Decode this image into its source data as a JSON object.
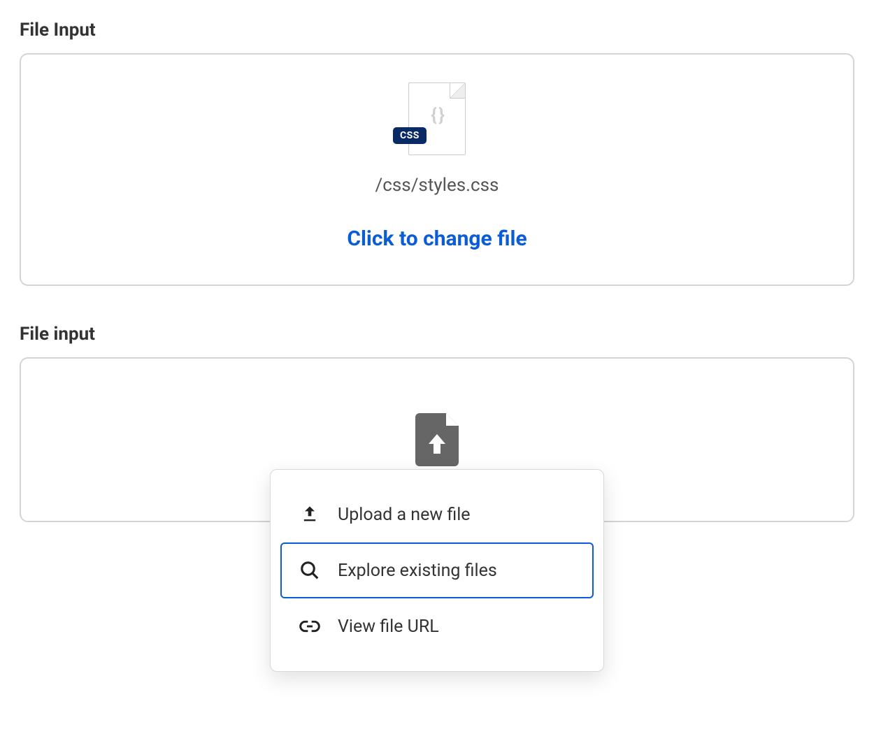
{
  "section1": {
    "label": "File Input",
    "file_badge": "CSS",
    "file_path": "/css/styles.css",
    "change_label": "Click to change file"
  },
  "section2": {
    "label": "File input",
    "menu": {
      "upload_label": "Upload a new file",
      "explore_label": "Explore existing files",
      "url_label": "View file URL"
    }
  }
}
